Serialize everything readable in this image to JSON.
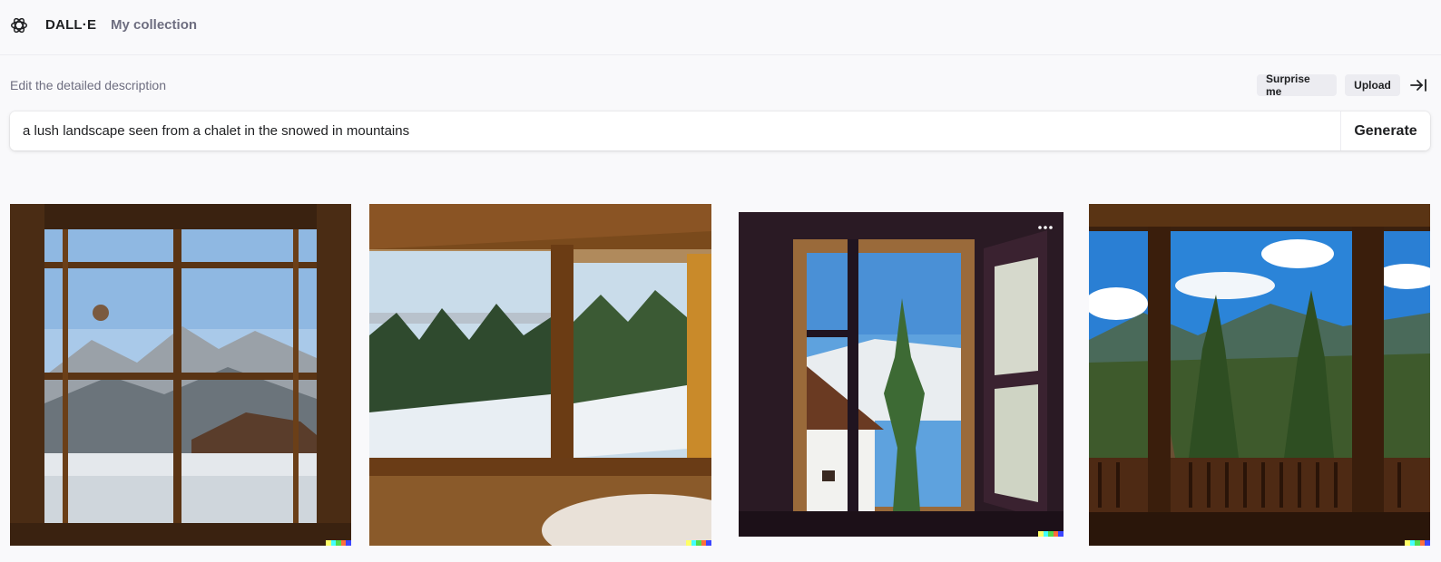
{
  "header": {
    "brand": "DALL·E",
    "nav": {
      "collection_label": "My collection"
    }
  },
  "editor": {
    "hint": "Edit the detailed description",
    "surprise_label": "Surprise me",
    "upload_label": "Upload",
    "prompt_value": "a lush landscape seen from a chalet in the snowed in mountains",
    "generate_label": "Generate"
  },
  "images": [
    {
      "name": "Generated image 1",
      "icon": "image"
    },
    {
      "name": "Generated image 2",
      "icon": "image"
    },
    {
      "name": "Generated image 3",
      "icon": "image",
      "menu_icon": "more-horizontal"
    },
    {
      "name": "Generated image 4",
      "icon": "image"
    }
  ],
  "signature_colors": [
    "#ffff66",
    "#42ffff",
    "#51da4c",
    "#ff6e3c",
    "#3c46ff"
  ],
  "colors": {
    "background": "#f9f9fb",
    "text": "#202123",
    "muted": "#6e6e80",
    "pill": "#ececf1"
  }
}
